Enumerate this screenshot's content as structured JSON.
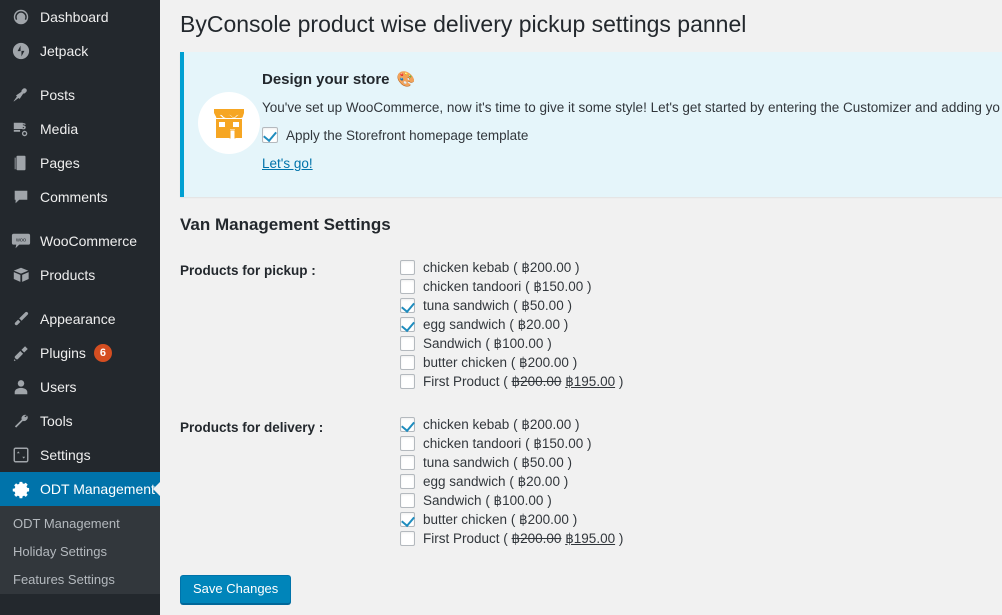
{
  "sidebar": {
    "groups": [
      {
        "items": [
          {
            "label": "Dashboard",
            "icon": "dashboard-icon"
          },
          {
            "label": "Jetpack",
            "icon": "jetpack-icon"
          }
        ]
      },
      {
        "items": [
          {
            "label": "Posts",
            "icon": "pin-icon"
          },
          {
            "label": "Media",
            "icon": "media-icon"
          },
          {
            "label": "Pages",
            "icon": "pages-icon"
          },
          {
            "label": "Comments",
            "icon": "comment-icon"
          }
        ]
      },
      {
        "items": [
          {
            "label": "WooCommerce",
            "icon": "woocommerce-icon"
          },
          {
            "label": "Products",
            "icon": "box-icon"
          }
        ]
      },
      {
        "items": [
          {
            "label": "Appearance",
            "icon": "paintbrush-icon"
          },
          {
            "label": "Plugins",
            "icon": "plug-icon",
            "badge": "6"
          },
          {
            "label": "Users",
            "icon": "user-icon"
          },
          {
            "label": "Tools",
            "icon": "wrench-icon"
          },
          {
            "label": "Settings",
            "icon": "sliders-icon"
          },
          {
            "label": "ODT Management",
            "icon": "gear-icon",
            "active": true
          }
        ]
      }
    ],
    "submenu": [
      {
        "label": "ODT Management"
      },
      {
        "label": "Holiday Settings"
      },
      {
        "label": "Features Settings"
      }
    ],
    "colors": {
      "background": "#23282d",
      "submenu_background": "#32373c",
      "active": "#0073aa",
      "badge": "#d54e21"
    }
  },
  "header": {
    "title": "ByConsole product wise delivery pickup settings pannel"
  },
  "notice": {
    "heading": "Design your store",
    "heading_emoji": "🎨",
    "description": "You've set up WooCommerce, now it's time to give it some style! Let's get started by entering the Customizer and adding yo",
    "checkbox_label": "Apply the Storefront homepage template",
    "checkbox_checked": true,
    "link_label": "Let's go!",
    "icon": "storefront-icon",
    "accent_color": "#00a0d2",
    "background_color": "#e5f5fa"
  },
  "main": {
    "section_heading": "Van Management Settings",
    "pickup": {
      "label": "Products for pickup :",
      "products": [
        {
          "name": "chicken kebab",
          "price": "( ฿200.00 )",
          "checked": false
        },
        {
          "name": "chicken tandoori",
          "price": "( ฿150.00 )",
          "checked": false
        },
        {
          "name": "tuna sandwich",
          "price": "( ฿50.00 )",
          "checked": true
        },
        {
          "name": "egg sandwich",
          "price": "( ฿20.00 )",
          "checked": true
        },
        {
          "name": "Sandwich",
          "price": "( ฿100.00 )",
          "checked": false
        },
        {
          "name": "butter chicken",
          "price": "( ฿200.00 )",
          "checked": false
        },
        {
          "name": "First Product",
          "price": "",
          "old_price": "฿200.00",
          "new_price": "฿195.00",
          "checked": false
        }
      ]
    },
    "delivery": {
      "label": "Products for delivery :",
      "products": [
        {
          "name": "chicken kebab",
          "price": "( ฿200.00 )",
          "checked": true
        },
        {
          "name": "chicken tandoori",
          "price": "( ฿150.00 )",
          "checked": false
        },
        {
          "name": "tuna sandwich",
          "price": "( ฿50.00 )",
          "checked": false
        },
        {
          "name": "egg sandwich",
          "price": "( ฿20.00 )",
          "checked": false
        },
        {
          "name": "Sandwich",
          "price": "( ฿100.00 )",
          "checked": false
        },
        {
          "name": "butter chicken",
          "price": "( ฿200.00 )",
          "checked": true
        },
        {
          "name": "First Product",
          "price": "",
          "old_price": "฿200.00",
          "new_price": "฿195.00",
          "checked": false
        }
      ]
    },
    "save_label": "Save Changes",
    "save_color": "#0085ba"
  }
}
